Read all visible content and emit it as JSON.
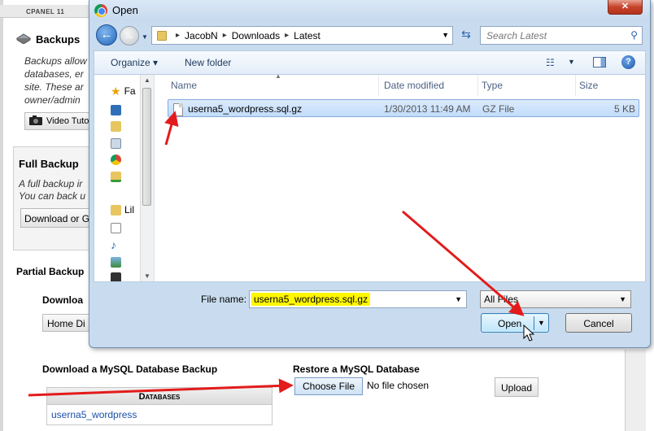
{
  "background": {
    "cpanel_tab": "CPANEL 11",
    "backups_title": "Backups",
    "backups_desc": [
      "Backups allow",
      "databases, er",
      "site. These ar",
      "owner/admin"
    ],
    "video_button": "Video Tuto",
    "full_backup_title": "Full Backup",
    "full_backup_desc": [
      "A full backup ir",
      "You can back u"
    ],
    "full_backup_button": "Download or G",
    "partial_backup_title": "Partial Backup",
    "download_home_title": "Downloa",
    "home_button": "Home Di",
    "mysql_download_title": "Download a MySQL Database Backup",
    "databases_header": "Databases",
    "database_row": "userna5_wordpress",
    "restore_title": "Restore a MySQL Database",
    "choose_file_button": "Choose File",
    "no_file_text": "No file chosen",
    "upload_button": "Upload"
  },
  "dialog": {
    "title": "Open",
    "close_glyph": "✕",
    "breadcrumb": [
      "JacobN",
      "Downloads",
      "Latest"
    ],
    "search_placeholder": "Search Latest",
    "toolbar": {
      "organize": "Organize ▾",
      "new_folder": "New folder",
      "help": "?"
    },
    "nav_items": [
      "Fa",
      "Lil"
    ],
    "columns": [
      "Name",
      "Date modified",
      "Type",
      "Size"
    ],
    "files": [
      {
        "name": "userna5_wordpress.sql.gz",
        "date": "1/30/2013 11:49 AM",
        "type": "GZ File",
        "size": "5 KB"
      }
    ],
    "file_name_label": "File name:",
    "file_name_value": "userna5_wordpress.sql.gz",
    "filter": "All Files",
    "open_button": "Open",
    "cancel_button": "Cancel"
  },
  "colors": {
    "highlight": "#fff700",
    "arrow": "#e31b1b",
    "selection": "#c1dcfc"
  }
}
